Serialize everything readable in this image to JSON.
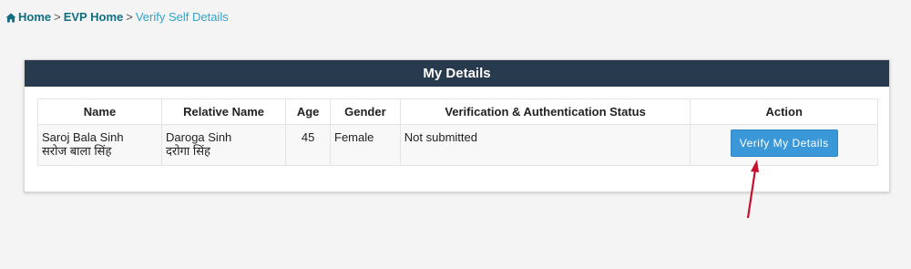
{
  "breadcrumb": {
    "home": "Home",
    "sep1": ">",
    "evp_home": "EVP Home",
    "sep2": ">",
    "current": "Verify Self Details"
  },
  "panel": {
    "title": "My Details"
  },
  "table": {
    "headers": [
      "Name",
      "Relative Name",
      "Age",
      "Gender",
      "Verification & Authentication Status",
      "Action"
    ],
    "rows": [
      {
        "name_en": "Saroj Bala Sinh",
        "name_hi": "सरोज बाला सिंह",
        "relative_en": "Daroga Sinh",
        "relative_hi": "दरोगा सिंह",
        "age": "45",
        "gender": "Female",
        "status": "Not submitted",
        "action_label": "Verify My Details"
      }
    ]
  },
  "colors": {
    "header_bg": "#283a4d",
    "button_bg": "#3a98d8",
    "link": "#0f6e80",
    "current_crumb": "#35a4c6",
    "arrow": "#c8102e"
  },
  "icons": {
    "home": "home-icon",
    "annotation": "red-arrow-icon"
  }
}
